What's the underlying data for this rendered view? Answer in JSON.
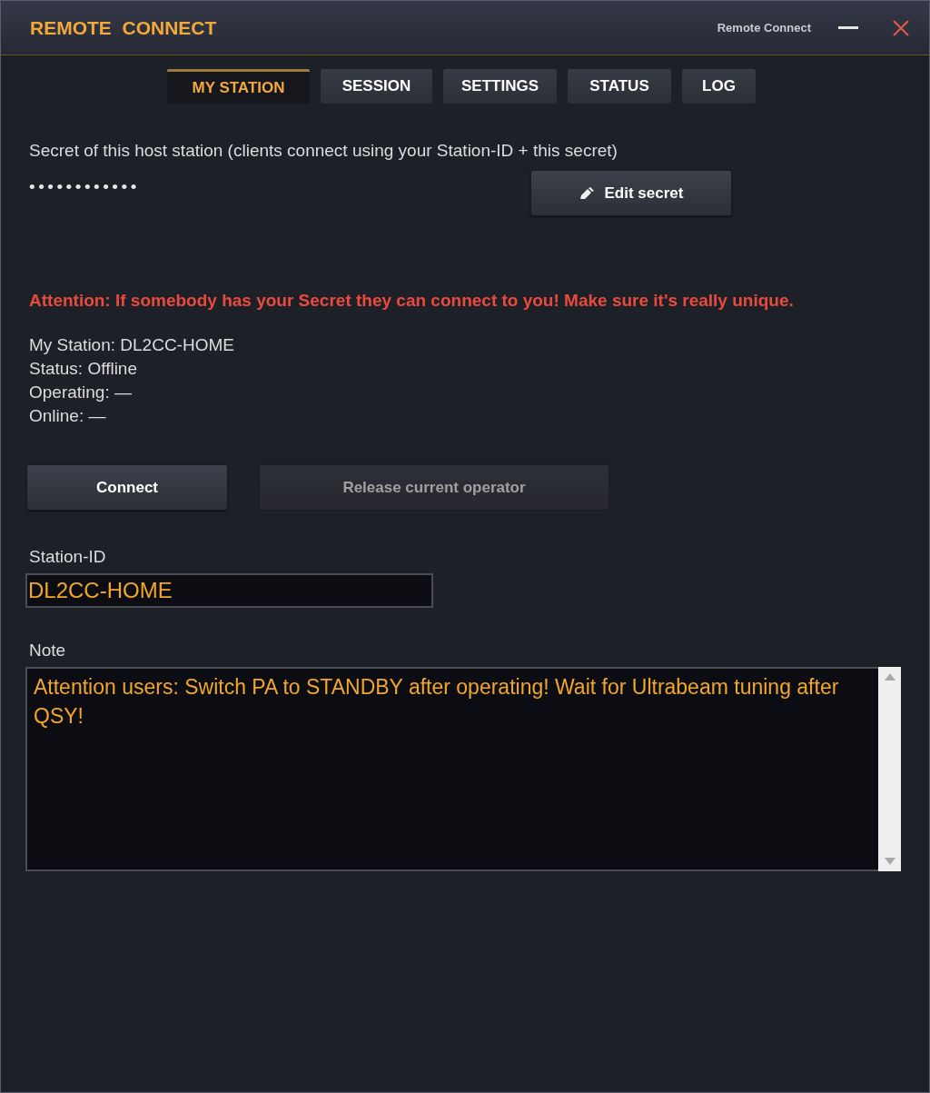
{
  "window": {
    "title": "REMOTE  CONNECT",
    "caption": "Remote Connect"
  },
  "tabs": [
    {
      "label": "MY STATION",
      "selected": true
    },
    {
      "label": "SESSION",
      "selected": false
    },
    {
      "label": "SETTINGS",
      "selected": false
    },
    {
      "label": "STATUS",
      "selected": false
    },
    {
      "label": "LOG",
      "selected": false
    }
  ],
  "secret": {
    "label": "Secret of this host station (clients connect using your Station-ID + this secret)",
    "value": "••••••••••••",
    "edit_button": "Edit secret"
  },
  "warning": "Attention: If somebody has your Secret they can connect to you! Make sure it's really unique.",
  "station_info": [
    "My Station: DL2CC-HOME",
    "Status: Offline",
    "Operating: —",
    "Online: —"
  ],
  "buttons": [
    {
      "label": "Connect",
      "disabled": false
    },
    {
      "label": "Release current operator",
      "disabled": true
    }
  ],
  "station_id": {
    "label": "Station-ID",
    "value": "DL2CC-HOME"
  },
  "note": {
    "label": "Note",
    "value": "Attention users: Switch PA to STANDBY after operating! Wait for Ultrabeam tuning after QSY!"
  }
}
